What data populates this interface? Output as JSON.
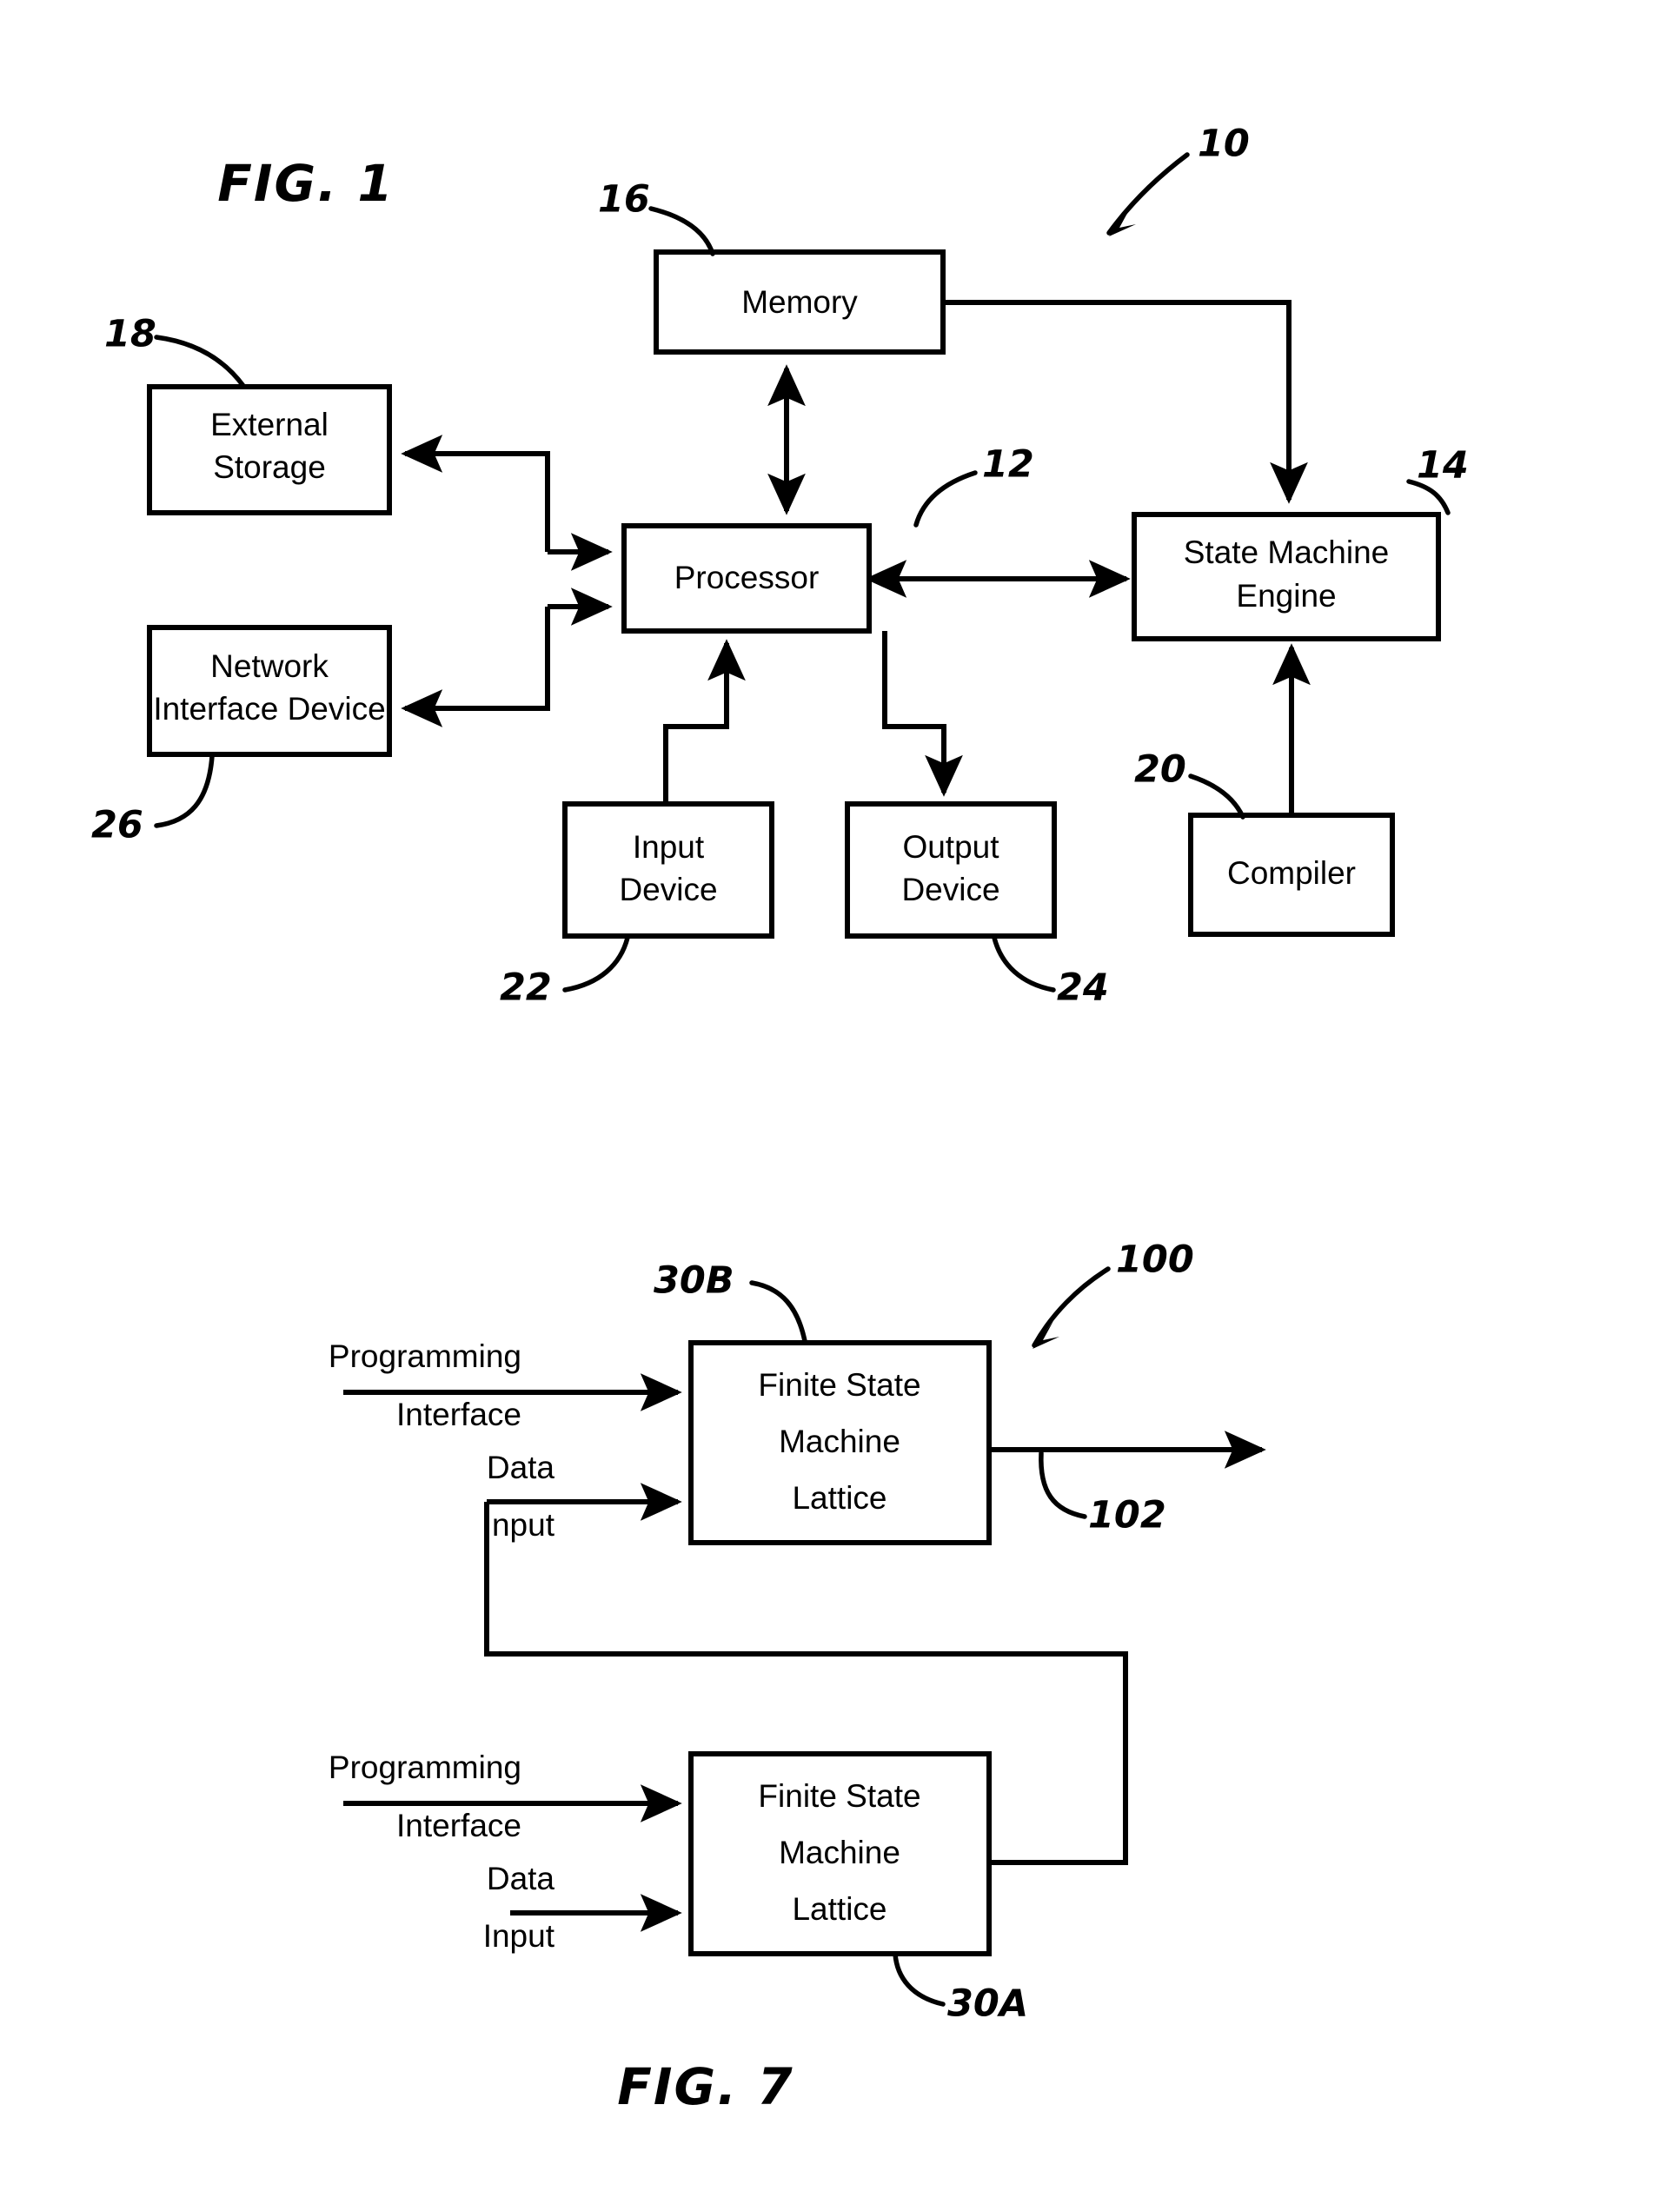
{
  "figures": [
    {
      "id": "fig1",
      "title": "FIG. 1",
      "blocks": [
        {
          "key": "memory",
          "lines": [
            "Memory"
          ]
        },
        {
          "key": "external",
          "lines": [
            "External",
            "Storage"
          ]
        },
        {
          "key": "network",
          "lines": [
            "Network",
            "Interface Device"
          ]
        },
        {
          "key": "processor",
          "lines": [
            "Processor"
          ]
        },
        {
          "key": "sme",
          "lines": [
            "State Machine",
            "Engine"
          ]
        },
        {
          "key": "input",
          "lines": [
            "Input",
            "Device"
          ]
        },
        {
          "key": "output",
          "lines": [
            "Output",
            "Device"
          ]
        },
        {
          "key": "compiler",
          "lines": [
            "Compiler"
          ]
        }
      ],
      "reference_numerals": [
        {
          "key": "system",
          "label": "10"
        },
        {
          "key": "memory",
          "label": "16"
        },
        {
          "key": "external",
          "label": "18"
        },
        {
          "key": "processor",
          "label": "12"
        },
        {
          "key": "sme",
          "label": "14"
        },
        {
          "key": "compiler",
          "label": "20"
        },
        {
          "key": "network",
          "label": "26"
        },
        {
          "key": "input",
          "label": "22"
        },
        {
          "key": "output",
          "label": "24"
        }
      ]
    },
    {
      "id": "fig7",
      "title": "FIG. 7",
      "blocks": [
        {
          "key": "fsm_top",
          "lines": [
            "Finite State",
            "Machine",
            "Lattice"
          ]
        },
        {
          "key": "fsm_bottom",
          "lines": [
            "Finite State",
            "Machine",
            "Lattice"
          ]
        }
      ],
      "input_labels": {
        "programming_line1": "Programming",
        "programming_line2": "Interface",
        "data_line1": "Data",
        "data_line2": "Input"
      },
      "reference_numerals": [
        {
          "key": "system",
          "label": "100"
        },
        {
          "key": "fsm_top",
          "label": "30B"
        },
        {
          "key": "output",
          "label": "102"
        },
        {
          "key": "fsm_bottom",
          "label": "30A"
        }
      ]
    }
  ],
  "colors": {
    "ink": "#000000",
    "paper": "#ffffff"
  }
}
